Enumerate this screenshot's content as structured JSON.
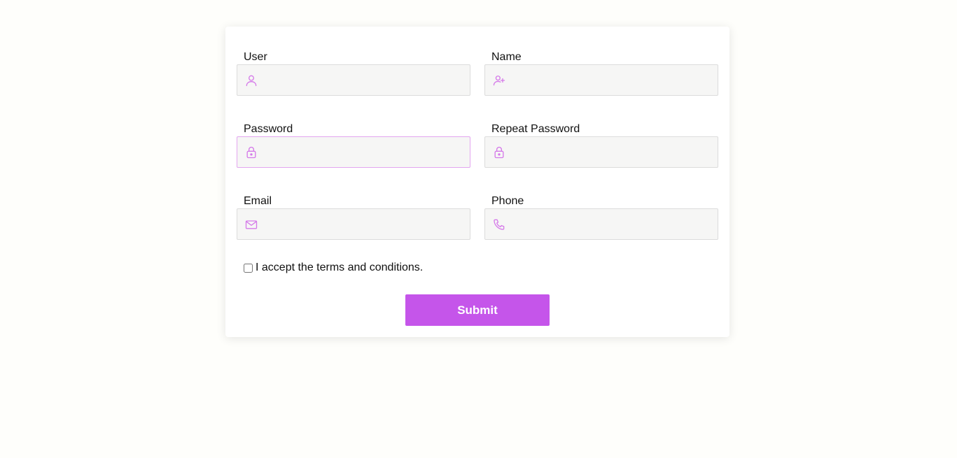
{
  "form": {
    "fields": {
      "user": {
        "label": "User",
        "value": "",
        "icon": "user-icon"
      },
      "name": {
        "label": "Name",
        "value": "",
        "icon": "user-plus-icon"
      },
      "password": {
        "label": "Password",
        "value": "",
        "icon": "lock-icon",
        "focused": true
      },
      "repeat_password": {
        "label": "Repeat Password",
        "value": "",
        "icon": "lock-icon"
      },
      "email": {
        "label": "Email",
        "value": "",
        "icon": "mail-icon"
      },
      "phone": {
        "label": "Phone",
        "value": "",
        "icon": "phone-icon"
      }
    },
    "terms": {
      "label": "I accept the terms and conditions.",
      "checked": false
    },
    "submit_label": "Submit"
  },
  "colors": {
    "accent": "#c555ea",
    "icon": "#d57ae9",
    "focus_border": "#e3a6f0",
    "input_bg": "#f6f6f5",
    "page_bg": "#fefefb"
  }
}
